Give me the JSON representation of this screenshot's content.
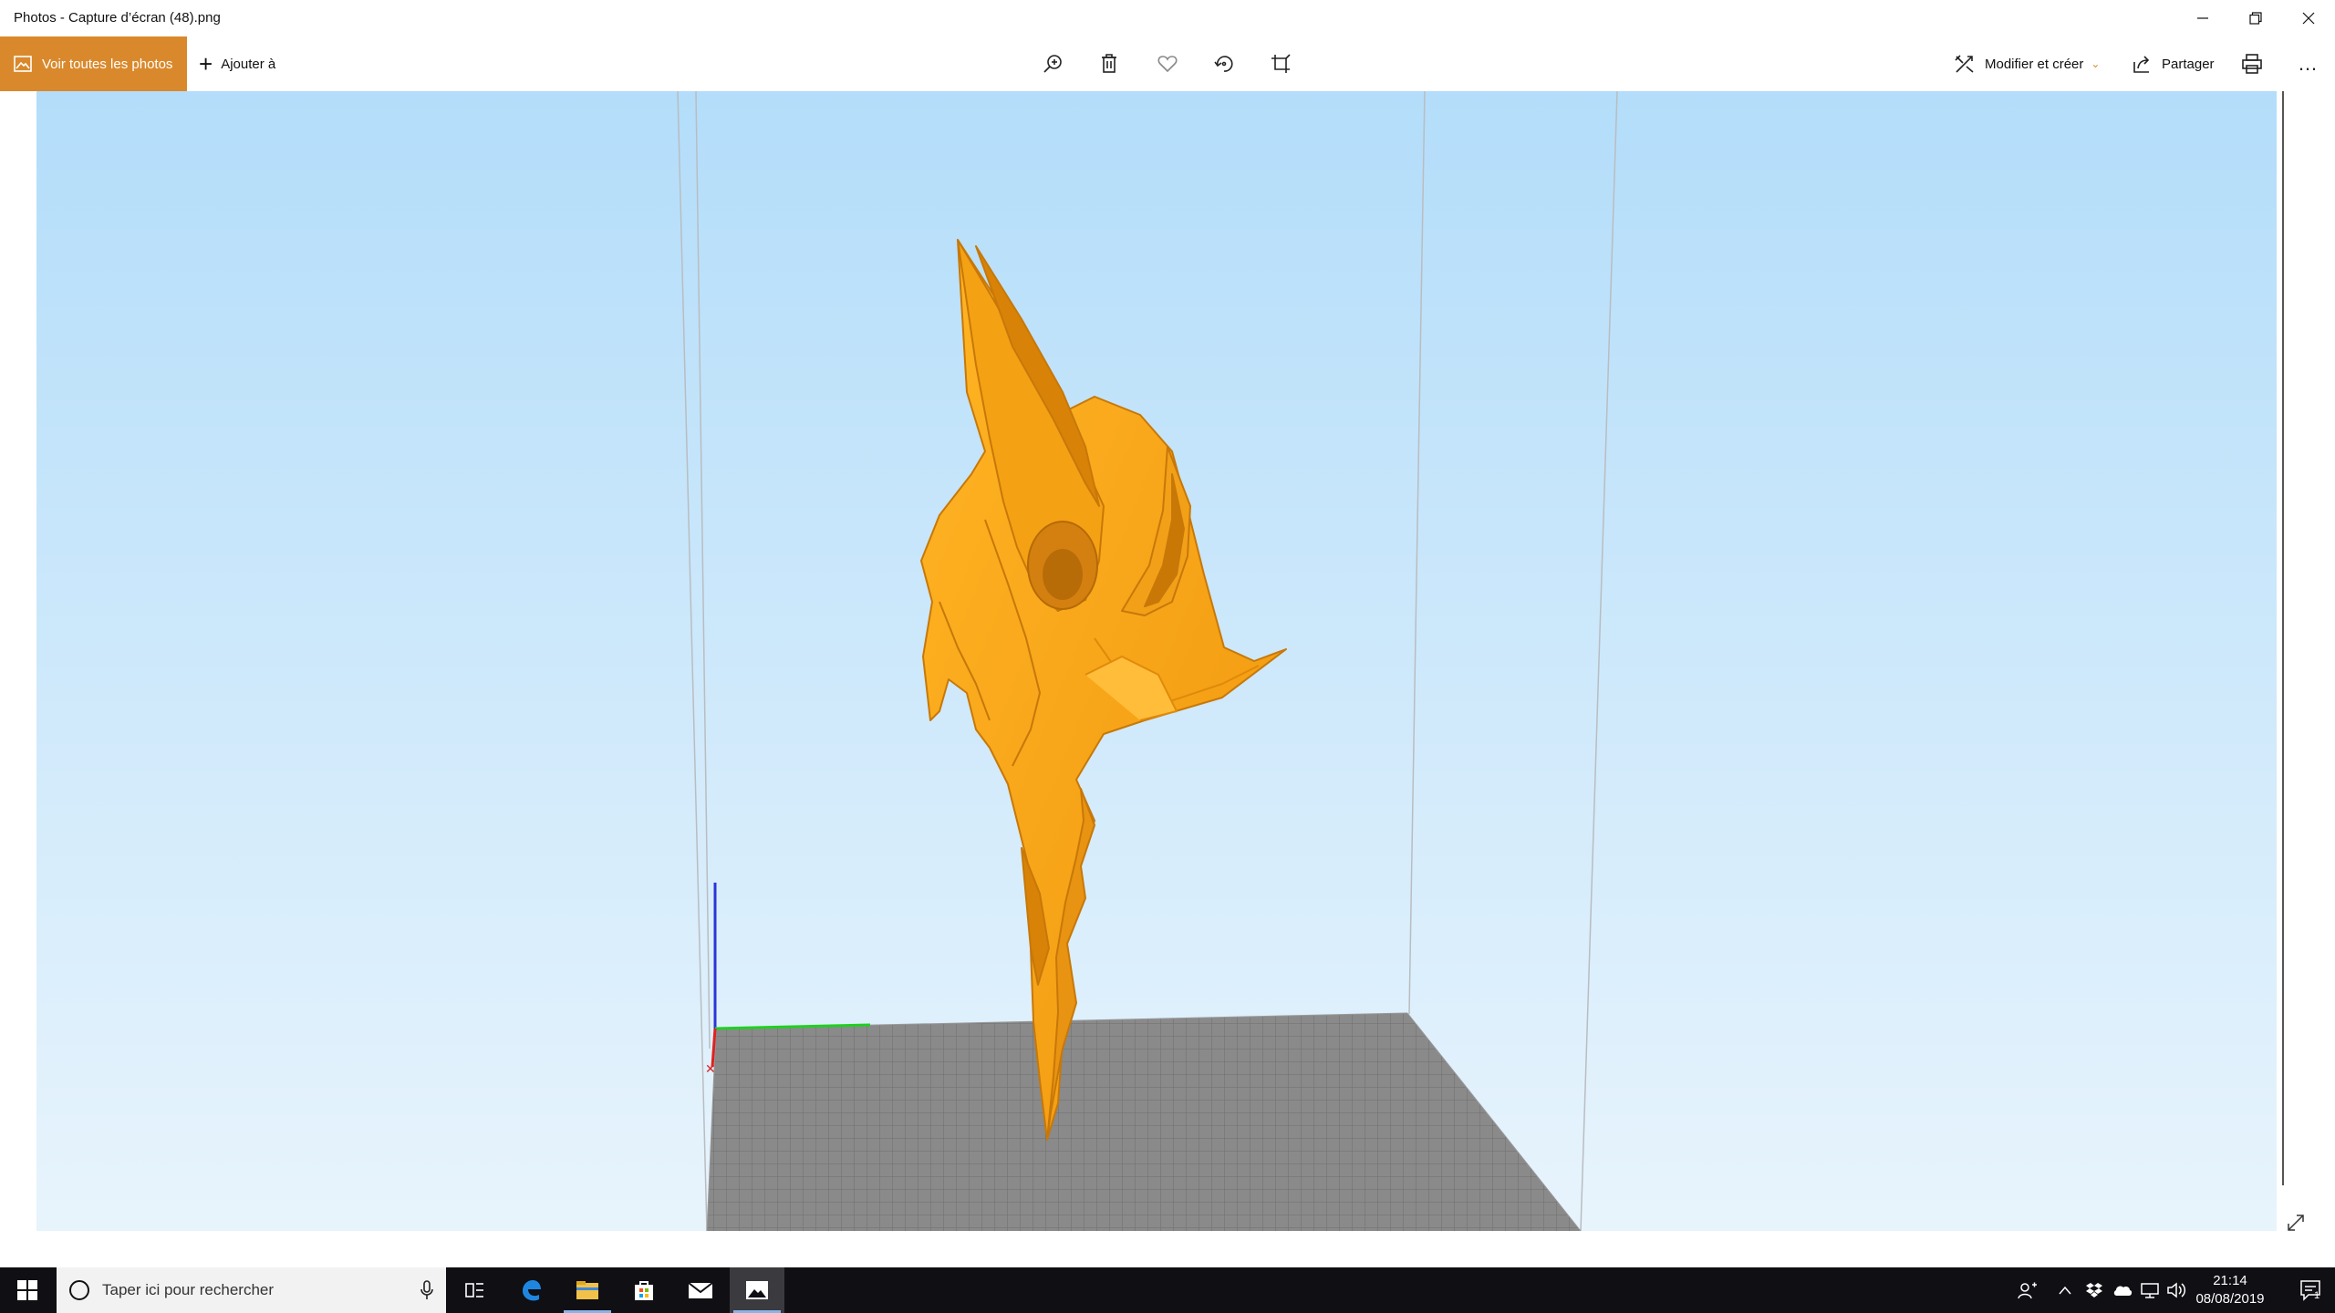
{
  "window": {
    "title": "Photos - Capture d’écran (48).png",
    "minimize_glyph": "—",
    "maximize_glyph": "restore",
    "close_glyph": "✕"
  },
  "commandbar": {
    "view_all_label": "Voir toutes les photos",
    "add_to_label": "Ajouter à",
    "tools": [
      "zoom-icon",
      "delete-icon",
      "favorite-icon",
      "rotate-icon",
      "crop-icon"
    ],
    "edit_create_label": "Modifier et créer",
    "share_label": "Partager",
    "more_glyph": "…"
  },
  "image": {
    "sky_top_color": "#b3ddfa",
    "sky_bottom_color": "#e8f4fc",
    "model_color": "#f7a81c",
    "platform_color": "#8a8a8a"
  },
  "taskbar": {
    "search_placeholder": "Taper ici pour rechercher",
    "time": "21:14",
    "date": "08/08/2019",
    "notification_count": "1",
    "apps": [
      "task-view-icon",
      "edge-icon",
      "file-explorer-icon",
      "store-icon",
      "mail-icon",
      "photos-icon"
    ]
  }
}
